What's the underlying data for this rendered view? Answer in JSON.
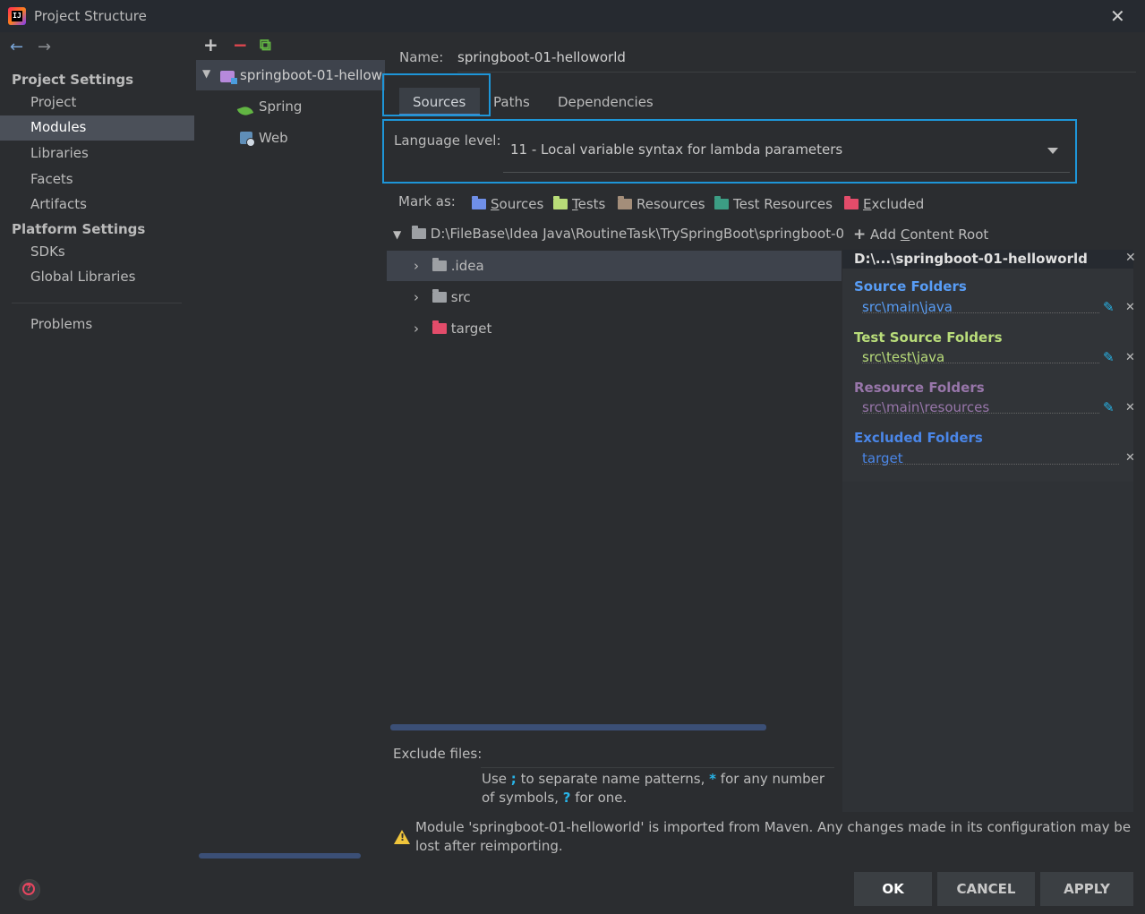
{
  "window": {
    "title": "Project Structure",
    "icon": "intellij-logo",
    "logo_text": "IJ",
    "close": "✕"
  },
  "nav": {
    "back": "←",
    "forward": "→",
    "project_settings_header": "Project Settings",
    "project_settings": [
      "Project",
      "Modules",
      "Libraries",
      "Facets",
      "Artifacts"
    ],
    "platform_settings_header": "Platform Settings",
    "platform_settings": [
      "SDKs",
      "Global Libraries"
    ],
    "problems": "Problems",
    "selected": "Modules"
  },
  "modules_toolbar": {
    "add": "+",
    "remove": "−",
    "copy": "⧉"
  },
  "module_tree": {
    "root": "springboot-01-hellow",
    "children": [
      "Spring",
      "Web"
    ]
  },
  "module": {
    "name_label": "Name:",
    "name_value": "springboot-01-helloworld"
  },
  "tabs": {
    "sources": "Sources",
    "paths": "Paths",
    "dependencies": "Dependencies",
    "active": "Sources"
  },
  "language_level": {
    "label": "Language level:",
    "value": "11 - Local variable syntax for lambda parameters"
  },
  "mark_as": {
    "label": "Mark as:",
    "sources": {
      "u": "S",
      "rest": "ources"
    },
    "tests": {
      "u": "T",
      "rest": "ests"
    },
    "resources": "Resources",
    "test_resources": "Test Resources",
    "excluded": {
      "u": "E",
      "rest": "xcluded"
    }
  },
  "content_tree": {
    "root": "D:\\FileBase\\Idea Java\\RoutineTask\\TrySpringBoot\\springboot-0",
    "children": [
      ".idea",
      "src",
      "target"
    ],
    "selected": ".idea"
  },
  "add_content_root": {
    "plus": "+",
    "pre": "Add ",
    "u": "C",
    "rest": "ontent Root"
  },
  "content_root_panel": {
    "title": "D:\\...\\springboot-01-helloworld",
    "source_folders_label": "Source Folders",
    "source_folders": [
      "src\\main\\java"
    ],
    "test_source_folders_label": "Test Source Folders",
    "test_source_folders": [
      "src\\test\\java"
    ],
    "resource_folders_label": "Resource Folders",
    "resource_folders": [
      "src\\main\\resources"
    ],
    "excluded_folders_label": "Excluded Folders",
    "excluded_folders": [
      "target"
    ],
    "colors": {
      "source": "#589df6",
      "test": "#b9dd7a",
      "resource": "#9876aa",
      "excluded": "#4a86e8"
    }
  },
  "exclude_files": {
    "label": "Exclude files:",
    "hint_pre": "Use ",
    "hint_sym1": ";",
    "hint_mid1": " to separate name patterns, ",
    "hint_sym2": "*",
    "hint_mid2": " for any number of symbols, ",
    "hint_sym3": "?",
    "hint_end": " for one."
  },
  "warning": {
    "icon": "warning-icon",
    "text": "Module 'springboot-01-helloworld' is imported from Maven. Any changes made in its configuration may be lost after reimporting."
  },
  "buttons": {
    "ok": "OK",
    "cancel": "CANCEL",
    "apply": "APPLY"
  },
  "help": "?"
}
